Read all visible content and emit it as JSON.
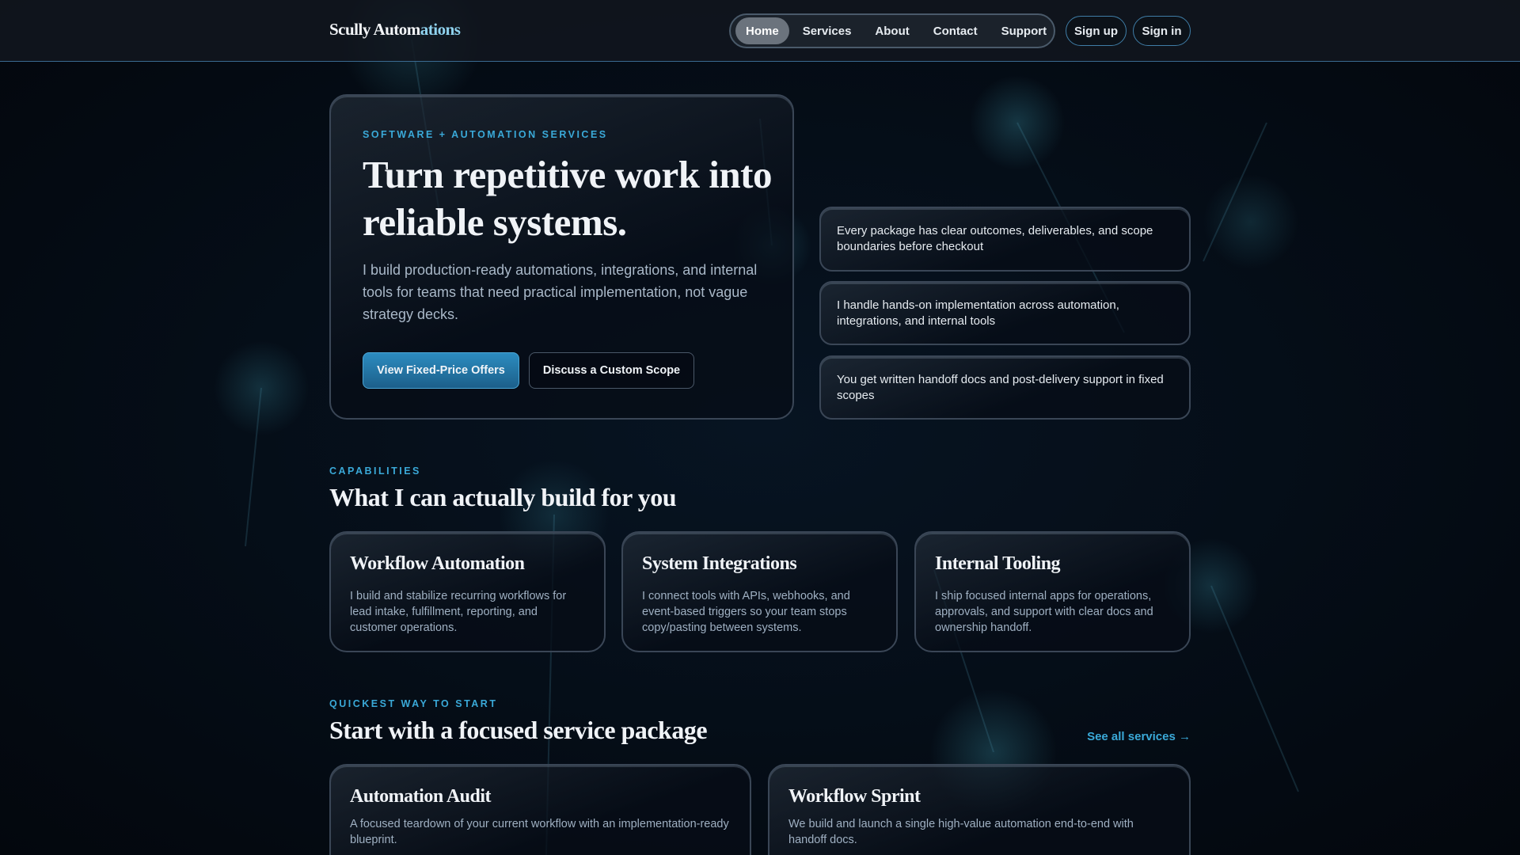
{
  "header": {
    "logo_main": "Scully Autom",
    "logo_accent": "ations",
    "nav": [
      {
        "label": "Home",
        "active": true
      },
      {
        "label": "Services"
      },
      {
        "label": "About"
      },
      {
        "label": "Contact"
      },
      {
        "label": "Support"
      }
    ],
    "sign_up": "Sign up",
    "sign_in": "Sign in"
  },
  "hero": {
    "eyebrow": "SOFTWARE + AUTOMATION SERVICES",
    "title": "Turn repetitive work into reliable systems.",
    "description": "I build production-ready automations, integrations, and internal tools for teams that need practical implementation, not vague strategy decks.",
    "primary_cta": "View Fixed-Price Offers",
    "secondary_cta": "Discuss a Custom Scope"
  },
  "points": [
    "Every package has clear outcomes, deliverables, and scope boundaries before checkout",
    "I handle hands-on implementation across automation, integrations, and internal tools",
    "You get written handoff docs and post-delivery support in fixed scopes"
  ],
  "capabilities": {
    "eyebrow": "CAPABILITIES",
    "title": "What I can actually build for you",
    "items": [
      {
        "title": "Workflow Automation",
        "text": "I build and stabilize recurring workflows for lead intake, fulfillment, reporting, and customer operations."
      },
      {
        "title": "System Integrations",
        "text": "I connect tools with APIs, webhooks, and event-based triggers so your team stops copy/pasting between systems."
      },
      {
        "title": "Internal Tooling",
        "text": "I ship focused internal apps for operations, approvals, and support with clear docs and ownership handoff."
      }
    ]
  },
  "packages": {
    "eyebrow": "QUICKEST WAY TO START",
    "title": "Start with a focused service package",
    "see_all": "See all services →",
    "items": [
      {
        "title": "Automation Audit",
        "text": "A focused teardown of your current workflow with an implementation-ready blueprint."
      },
      {
        "title": "Workflow Sprint",
        "text": "We build and launch a single high-value automation end-to-end with handoff docs."
      }
    ]
  }
}
